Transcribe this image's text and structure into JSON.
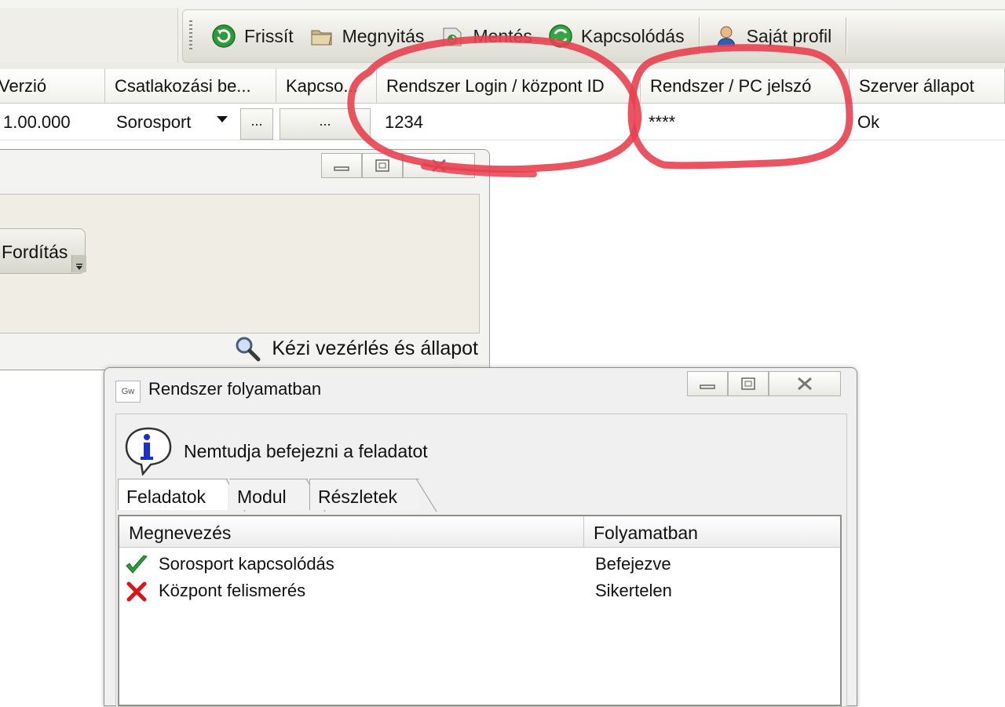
{
  "toolbar": {
    "items": [
      {
        "label": "Frissít",
        "icon": "refresh-icon"
      },
      {
        "label": "Megnyitás",
        "icon": "open-folder-icon"
      },
      {
        "label": "Mentés",
        "icon": "save-icon"
      },
      {
        "label": "Kapcsolódás",
        "icon": "connect-icon"
      },
      {
        "label": "Saját profil",
        "icon": "user-profile-icon"
      }
    ]
  },
  "grid": {
    "columns": [
      "Verzió",
      "Csatlakozási be...",
      "Kapcso...",
      "Rendszer Login / központ ID",
      "Rendszer / PC jelszó",
      "Szerver állapot"
    ],
    "row": {
      "version": "1.00.000",
      "connection": "Sorosport",
      "ellipsis1": "...",
      "ellipsis2": "...",
      "login_id": "1234",
      "password": "****",
      "server_status": "Ok"
    }
  },
  "background_window": {
    "button_label": "Fordítás",
    "status_link": "Kézi vezérlés és állapot"
  },
  "dialog": {
    "title": "Rendszer folyamatban",
    "app_icon_text": "Gw",
    "message": "Nemtudja befejezni a feladatot",
    "tabs": [
      "Feladatok",
      "Modul",
      "Részletek"
    ],
    "list_columns": [
      "Megnevezés",
      "Folyamatban"
    ],
    "rows": [
      {
        "name": "Sorosport kapcsolódás",
        "status": "Befejezve",
        "result": "success"
      },
      {
        "name": "Központ felismerés",
        "status": "Sikertelen",
        "result": "failed"
      }
    ]
  },
  "annotation_color": "#e8404f"
}
